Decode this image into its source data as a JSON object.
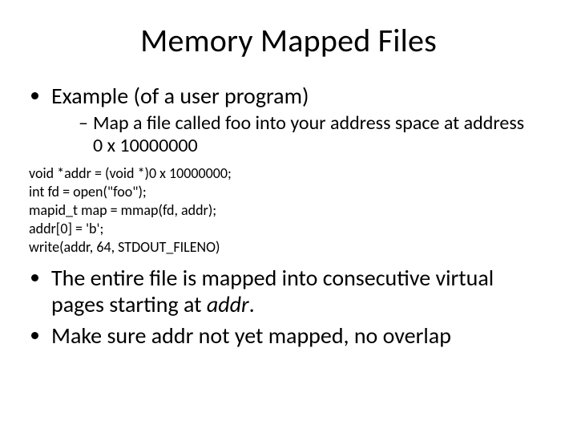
{
  "title": "Memory Mapped Files",
  "bullet1": "Example (of a user program)",
  "sub1_a": "Map a file called foo into your address space at address",
  "sub1_b": "0 x 10000000",
  "code": {
    "l1": "void *addr = (void *)0 x 10000000;",
    "l2": "int fd = open(\"foo\");",
    "l3": "mapid_t map = mmap(fd, addr);",
    "l4": "addr[0] = 'b';",
    "l5": "write(addr, 64, STDOUT_FILENO)"
  },
  "bullet2_a": "The entire file is mapped into consecutive virtual",
  "bullet2_b": "pages starting at ",
  "bullet2_c": "addr",
  "bullet2_d": ".",
  "bullet3": "Make sure addr not yet mapped, no overlap"
}
